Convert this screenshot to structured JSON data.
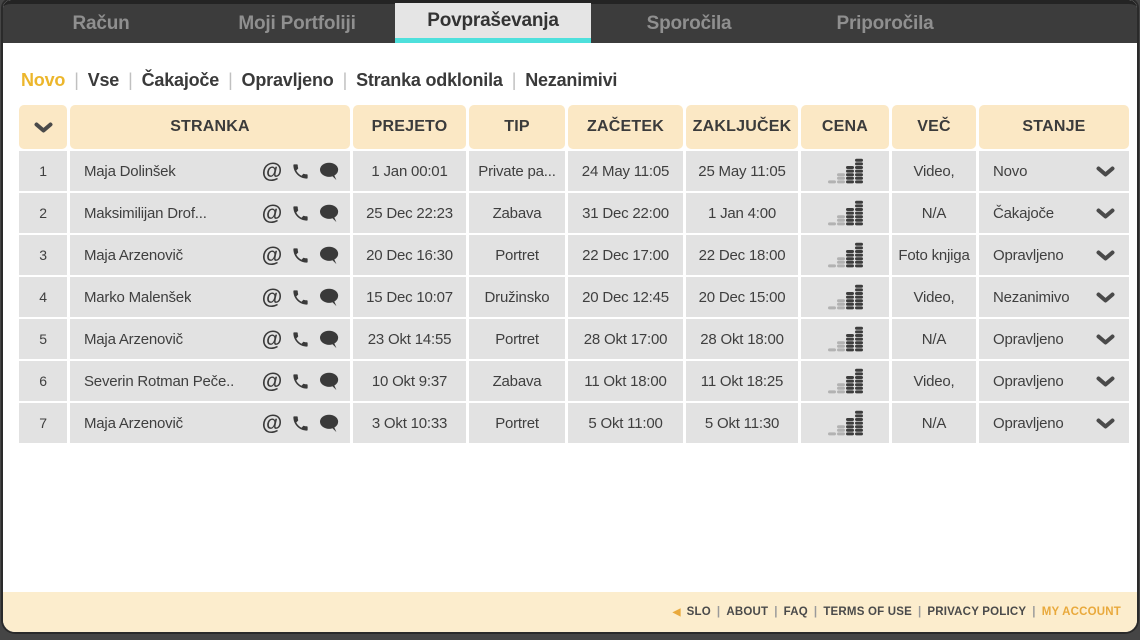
{
  "colors": {
    "accent_underline": "#4ee0dc",
    "active_filter": "#ecb62c",
    "header_bg": "#fbe8c5",
    "row_bg": "#e2e2e2",
    "footer_bg": "#fcedcd",
    "footer_accent": "#e9a93c",
    "tabbar_bg": "#3c3c3c"
  },
  "tabs": [
    {
      "label": "Račun",
      "active": false
    },
    {
      "label": "Moji Portfoliji",
      "active": false
    },
    {
      "label": "Povpraševanja",
      "active": true
    },
    {
      "label": "Sporočila",
      "active": false
    },
    {
      "label": "Priporočila",
      "active": false
    }
  ],
  "filters": {
    "active": "Novo",
    "items": [
      "Novo",
      "Vse",
      "Čakajoče",
      "Opravljeno",
      "Stranka odklonila",
      "Nezanimivi"
    ]
  },
  "table": {
    "headers": [
      "STRANKA",
      "PREJETO",
      "TIP",
      "ZAČETEK",
      "ZAKLJUČEK",
      "CENA",
      "VEČ",
      "STANJE"
    ],
    "contact_icon_names": [
      "email-at-icon",
      "phone-icon",
      "chat-bubble-icon"
    ],
    "price_icon_name": "price-coins-icon",
    "rows": [
      {
        "num": "1",
        "client": "Maja Dolinšek",
        "received": "1 Jan 00:01",
        "type": "Private pa...",
        "start": "24 May 11:05",
        "end": "25 May 11:05",
        "more": "Video,",
        "status": "Novo"
      },
      {
        "num": "2",
        "client": "Maksimilijan Drof...",
        "received": "25 Dec 22:23",
        "type": "Zabava",
        "start": "31 Dec 22:00",
        "end": "1 Jan 4:00",
        "more": "N/A",
        "status": "Čakajoče"
      },
      {
        "num": "3",
        "client": "Maja Arzenovič",
        "received": "20 Dec 16:30",
        "type": "Portret",
        "start": "22 Dec 17:00",
        "end": "22 Dec 18:00",
        "more": "Foto knjiga",
        "status": "Opravljeno"
      },
      {
        "num": "4",
        "client": "Marko Malenšek",
        "received": "15 Dec 10:07",
        "type": "Družinsko",
        "start": "20 Dec 12:45",
        "end": "20 Dec 15:00",
        "more": "Video,",
        "status": "Nezanimivo"
      },
      {
        "num": "5",
        "client": "Maja Arzenovič",
        "received": "23 Okt 14:55",
        "type": "Portret",
        "start": "28 Okt 17:00",
        "end": "28 Okt 18:00",
        "more": "N/A",
        "status": "Opravljeno"
      },
      {
        "num": "6",
        "client": "Severin Rotman Peče..",
        "received": "10 Okt 9:37",
        "type": "Zabava",
        "start": "11 Okt 18:00",
        "end": "11 Okt 18:25",
        "more": "Video,",
        "status": "Opravljeno"
      },
      {
        "num": "7",
        "client": "Maja Arzenovič",
        "received": "3 Okt 10:33",
        "type": "Portret",
        "start": "5 Okt 11:00",
        "end": "5 Okt 11:30",
        "more": "N/A",
        "status": "Opravljeno"
      }
    ]
  },
  "footer": {
    "back_arrow": "◀",
    "links": [
      "SLO",
      "ABOUT",
      "FAQ",
      "TERMS OF USE",
      "PRIVACY POLICY",
      "MY ACCOUNT"
    ],
    "accent_link": "MY ACCOUNT"
  }
}
